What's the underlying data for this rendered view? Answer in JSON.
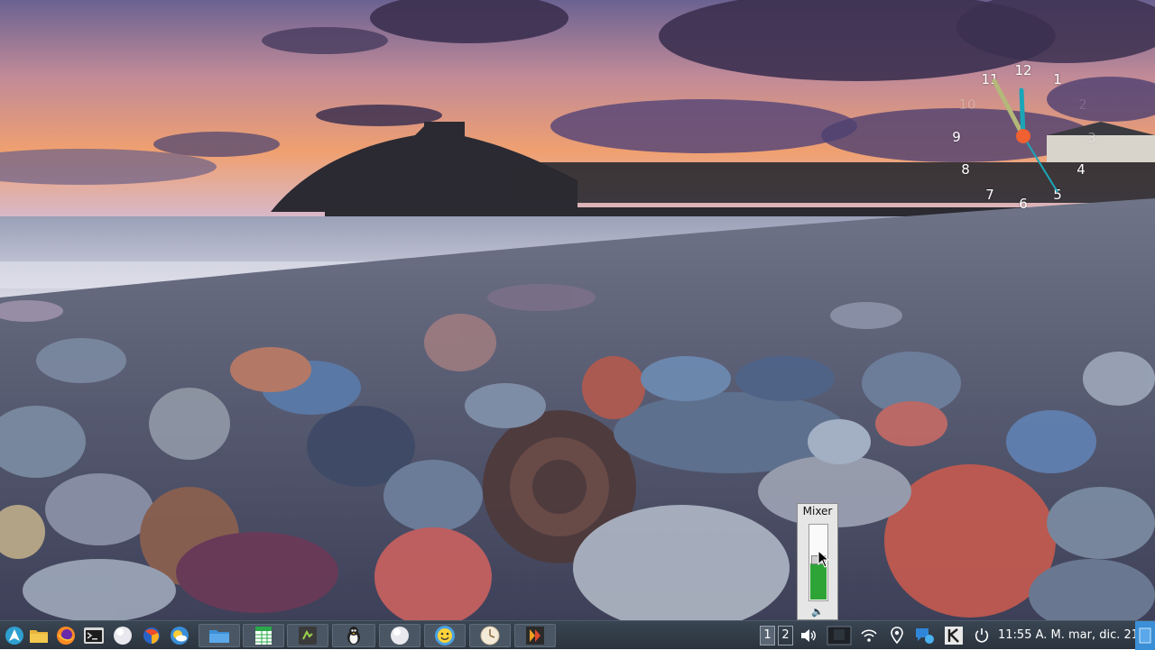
{
  "desktop": {
    "wallpaper": "pebble-beach-castle-sunset",
    "colors": {
      "sky_top": "#7a6fa0",
      "sky_glow": "#f0a070",
      "sea": "#b8c0d0",
      "cloud": "#3c3050"
    }
  },
  "clock_widget": {
    "numbers": [
      "12",
      "1",
      "2",
      "3",
      "4",
      "5",
      "6",
      "7",
      "8",
      "9",
      "10",
      "11"
    ],
    "time": "11:55",
    "colors": {
      "hour_hand": "#b4b87a",
      "minute_hand": "#1aa6b8",
      "second_hand": "#1aa6b8",
      "center": "#f06030"
    }
  },
  "mixer": {
    "title": "Mixer",
    "volume_fraction": 0.48,
    "icon": "speaker-icon"
  },
  "taskbar": {
    "launchers": [
      {
        "name": "app-menu",
        "icon": "arch-logo-icon"
      },
      {
        "name": "file-manager",
        "icon": "folder-icon"
      },
      {
        "name": "firefox",
        "icon": "firefox-icon"
      },
      {
        "name": "terminal",
        "icon": "terminal-icon"
      },
      {
        "name": "blank-app",
        "icon": "white-circle-icon"
      },
      {
        "name": "browser",
        "icon": "browser-icon"
      },
      {
        "name": "weather",
        "icon": "weather-icon"
      }
    ],
    "windows": [
      {
        "name": "files",
        "icon": "folder-icon"
      },
      {
        "name": "spreadsheet",
        "icon": "spreadsheet-icon"
      },
      {
        "name": "app-dark",
        "icon": "dark-app-icon"
      },
      {
        "name": "mascot",
        "icon": "penguin-icon"
      },
      {
        "name": "circle-app",
        "icon": "white-circle-icon"
      },
      {
        "name": "smiley",
        "icon": "smiley-icon"
      },
      {
        "name": "clock-app",
        "icon": "clock-icon"
      },
      {
        "name": "media",
        "icon": "media-icon"
      }
    ],
    "workspaces": [
      "1",
      "2"
    ],
    "tray": [
      "volume-icon",
      "display-icon",
      "wifi-icon",
      "location-icon",
      "chat-icon",
      "k-icon",
      "power-icon"
    ],
    "clock": "11:55 A. M. mar, dic. 21",
    "accent": "#3b8fd6"
  }
}
